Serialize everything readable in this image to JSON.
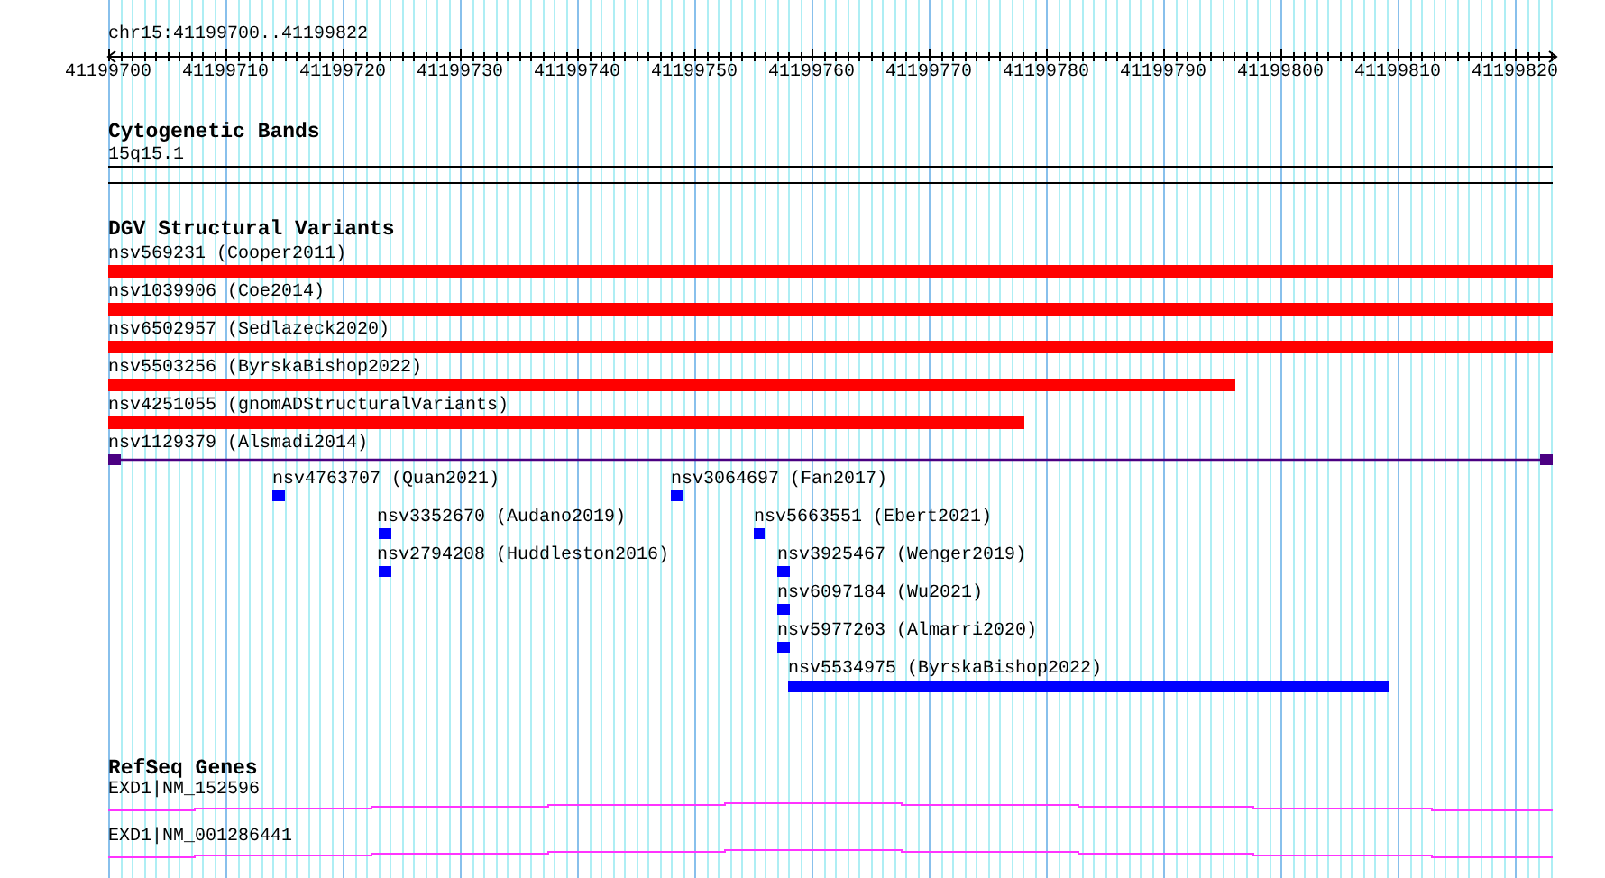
{
  "location": "chr15:41199700..41199822",
  "ruler": {
    "labels": [
      "41199700",
      "41199710",
      "41199720",
      "41199730",
      "41199740",
      "41199750",
      "41199760",
      "41199770",
      "41199780",
      "41199790",
      "41199800",
      "41199810",
      "41199820"
    ]
  },
  "tracks": [
    {
      "title": "Cytogenetic Bands",
      "features": [
        {
          "label": "15q15.1",
          "kind": "band"
        }
      ]
    },
    {
      "title": "DGV Structural Variants",
      "features": [
        {
          "label": "nsv569231 (Cooper2011)",
          "kind": "bar",
          "color": "#ff0000"
        },
        {
          "label": "nsv1039906 (Coe2014)",
          "kind": "bar",
          "color": "#ff0000"
        },
        {
          "label": "nsv6502957 (Sedlazeck2020)",
          "kind": "bar",
          "color": "#ff0000"
        },
        {
          "label": "nsv5503256 (ByrskaBishop2022)",
          "kind": "bar",
          "color": "#ff0000"
        },
        {
          "label": "nsv4251055 (gnomADStructuralVariants)",
          "kind": "bar",
          "color": "#ff0000"
        },
        {
          "label": "nsv1129379 (Alsmadi2014)",
          "kind": "span",
          "color": "#4b0082"
        },
        {
          "label": "nsv4763707 (Quan2021)",
          "kind": "bar",
          "color": "#0000ff"
        },
        {
          "label": "nsv3064697 (Fan2017)",
          "kind": "bar",
          "color": "#0000ff"
        },
        {
          "label": "nsv3352670 (Audano2019)",
          "kind": "bar",
          "color": "#0000ff"
        },
        {
          "label": "nsv5663551 (Ebert2021)",
          "kind": "bar",
          "color": "#0000ff"
        },
        {
          "label": "nsv2794208 (Huddleston2016)",
          "kind": "bar",
          "color": "#0000ff"
        },
        {
          "label": "nsv3925467 (Wenger2019)",
          "kind": "bar",
          "color": "#0000ff"
        },
        {
          "label": "nsv6097184 (Wu2021)",
          "kind": "bar",
          "color": "#0000ff"
        },
        {
          "label": "nsv5977203 (Almarri2020)",
          "kind": "bar",
          "color": "#0000ff"
        },
        {
          "label": "nsv5534975 (ByrskaBishop2022)",
          "kind": "bar",
          "color": "#0000ff"
        }
      ]
    },
    {
      "title": "RefSeq Genes",
      "features": [
        {
          "label": "EXD1|NM_152596",
          "kind": "gene"
        },
        {
          "label": "EXD1|NM_001286441",
          "kind": "gene"
        }
      ]
    }
  ]
}
